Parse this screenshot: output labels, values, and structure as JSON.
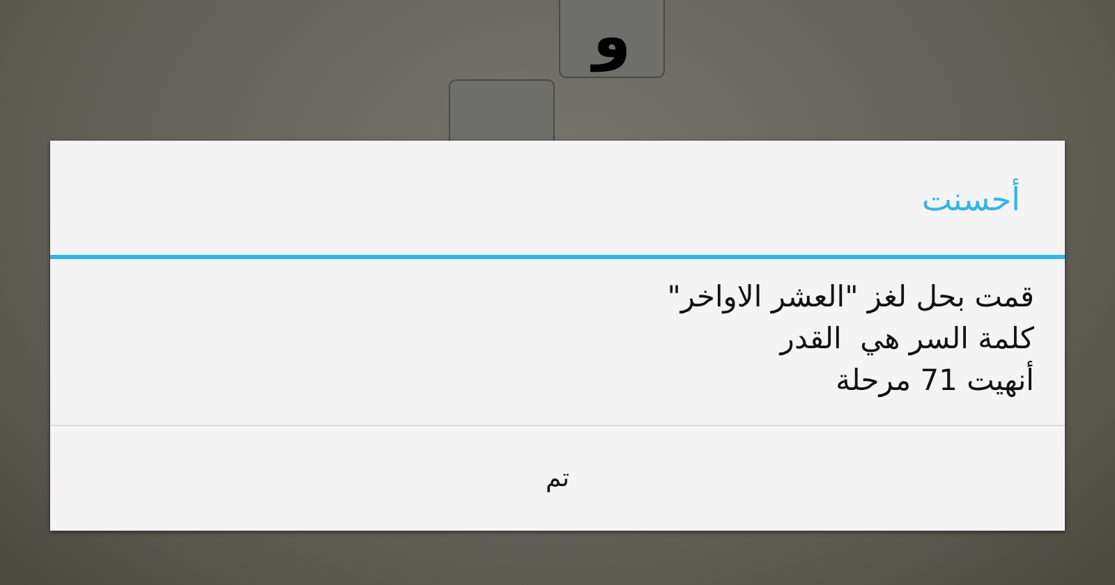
{
  "game_tiles": [
    {
      "letter": "و"
    }
  ],
  "dialog": {
    "title": "أحسنت",
    "message_lines": [
      "قمت بحل لغز \"العشر الاواخر\"",
      "كلمة السر هي  القدر",
      "أنهيت 71 مرحلة"
    ],
    "buttons": [
      "تم"
    ]
  }
}
